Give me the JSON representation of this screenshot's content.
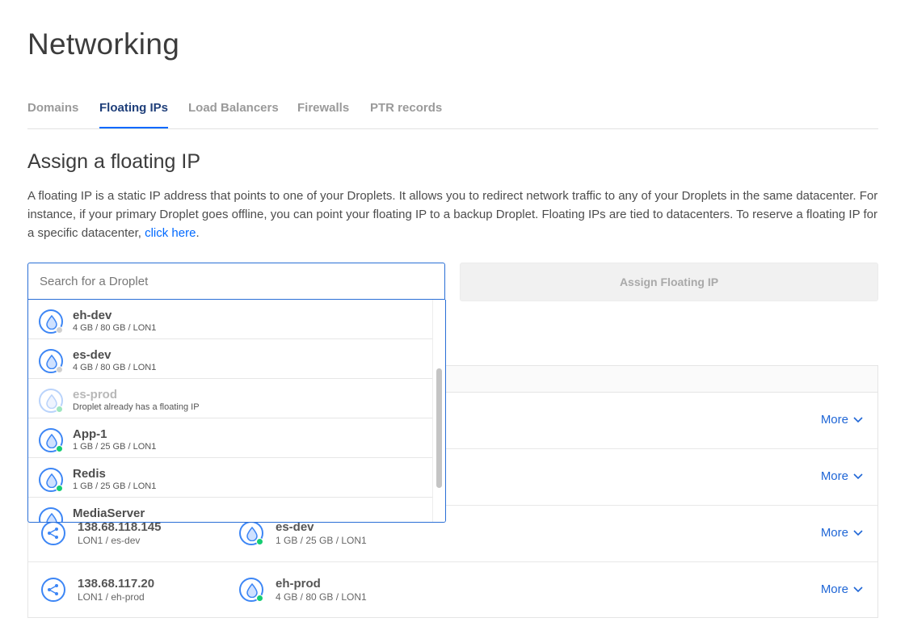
{
  "page": {
    "title": "Networking"
  },
  "tabs": [
    {
      "label": "Domains",
      "active": false
    },
    {
      "label": "Floating IPs",
      "active": true
    },
    {
      "label": "Load Balancers",
      "active": false
    },
    {
      "label": "Firewalls",
      "active": false
    },
    {
      "label": "PTR records",
      "active": false
    }
  ],
  "assign": {
    "title": "Assign a floating IP",
    "description": "A floating IP is a static IP address that points to one of your Droplets. It allows you to redirect network traffic to any of your Droplets in the same datacenter. For instance, if your primary Droplet goes offline, you can point your floating IP to a backup Droplet. Floating IPs are tied to datacenters. To reserve a floating IP for a specific datacenter, ",
    "link_text": "click here",
    "link_suffix": ".",
    "search_placeholder": "Search for a Droplet",
    "button_label": "Assign Floating IP"
  },
  "dropdown": [
    {
      "name": "eh-dev",
      "spec": "4 GB / 80 GB / LON1",
      "status": "off",
      "disabled": false
    },
    {
      "name": "es-dev",
      "spec": "4 GB / 80 GB / LON1",
      "status": "off",
      "disabled": false
    },
    {
      "name": "es-prod",
      "spec": "Droplet already has a floating IP",
      "status": "on",
      "disabled": true
    },
    {
      "name": "App-1",
      "spec": "1 GB / 25 GB / LON1",
      "status": "on",
      "disabled": false
    },
    {
      "name": "Redis",
      "spec": "1 GB / 25 GB / LON1",
      "status": "on",
      "disabled": false
    },
    {
      "name": "MediaServer",
      "spec": "",
      "status": "on",
      "disabled": false
    }
  ],
  "table": {
    "rows": [
      {
        "more": "More"
      },
      {
        "more": "More"
      },
      {
        "ip": "138.68.118.145",
        "location": "LON1 / es-dev",
        "droplet": "es-dev",
        "spec": "1 GB / 25 GB / LON1",
        "status": "on",
        "more": "More"
      },
      {
        "ip": "138.68.117.20",
        "location": "LON1 / eh-prod",
        "droplet": "eh-prod",
        "spec": "4 GB / 80 GB / LON1",
        "status": "on",
        "more": "More"
      }
    ]
  },
  "colors": {
    "accent": "#0069ff",
    "status_on": "#15cd72",
    "status_off": "#d0d0d0"
  },
  "icons": {
    "droplet": "droplet-icon",
    "floating_ip": "floating-ip-icon",
    "chevron": "chevron-down-icon"
  }
}
